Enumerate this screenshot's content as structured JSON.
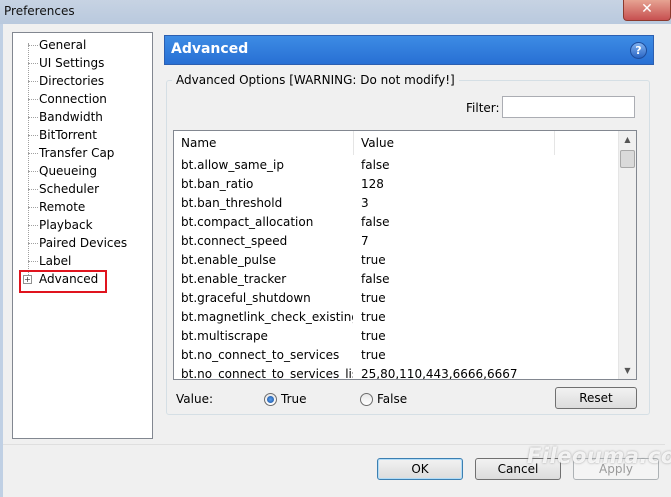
{
  "window": {
    "title": "Preferences",
    "close_glyph": "✕"
  },
  "tree": {
    "items": [
      {
        "label": "General"
      },
      {
        "label": "UI Settings"
      },
      {
        "label": "Directories"
      },
      {
        "label": "Connection"
      },
      {
        "label": "Bandwidth"
      },
      {
        "label": "BitTorrent"
      },
      {
        "label": "Transfer Cap"
      },
      {
        "label": "Queueing"
      },
      {
        "label": "Scheduler"
      },
      {
        "label": "Remote"
      },
      {
        "label": "Playback"
      },
      {
        "label": "Paired Devices"
      },
      {
        "label": "Label"
      },
      {
        "label": "Advanced",
        "selected": true
      }
    ],
    "expander_glyph": "+",
    "highlight_color": "#e0141e"
  },
  "panel": {
    "header_title": "Advanced",
    "help_glyph": "?",
    "group_title": "Advanced Options [WARNING: Do not modify!]",
    "filter_label": "Filter:",
    "filter_value": ""
  },
  "table": {
    "columns": [
      "Name",
      "Value"
    ],
    "rows": [
      [
        "bt.allow_same_ip",
        "false"
      ],
      [
        "bt.ban_ratio",
        "128"
      ],
      [
        "bt.ban_threshold",
        "3"
      ],
      [
        "bt.compact_allocation",
        "false"
      ],
      [
        "bt.connect_speed",
        "7"
      ],
      [
        "bt.enable_pulse",
        "true"
      ],
      [
        "bt.enable_tracker",
        "false"
      ],
      [
        "bt.graceful_shutdown",
        "true"
      ],
      [
        "bt.magnetlink_check_existing_...",
        "true"
      ],
      [
        "bt.multiscrape",
        "true"
      ],
      [
        "bt.no_connect_to_services",
        "true"
      ],
      [
        "bt.no_connect_to_services_list",
        "25,80,110,443,6666,6667"
      ]
    ]
  },
  "value_editor": {
    "label": "Value:",
    "option_true": "True",
    "option_false": "False",
    "selected": "True",
    "reset_label": "Reset"
  },
  "footer": {
    "ok_label": "OK",
    "cancel_label": "Cancel",
    "apply_label": "Apply"
  },
  "watermark": "Fileouma.com",
  "colors": {
    "header_blue": "#2f7ddc",
    "title_bar": "#bfcde0"
  }
}
